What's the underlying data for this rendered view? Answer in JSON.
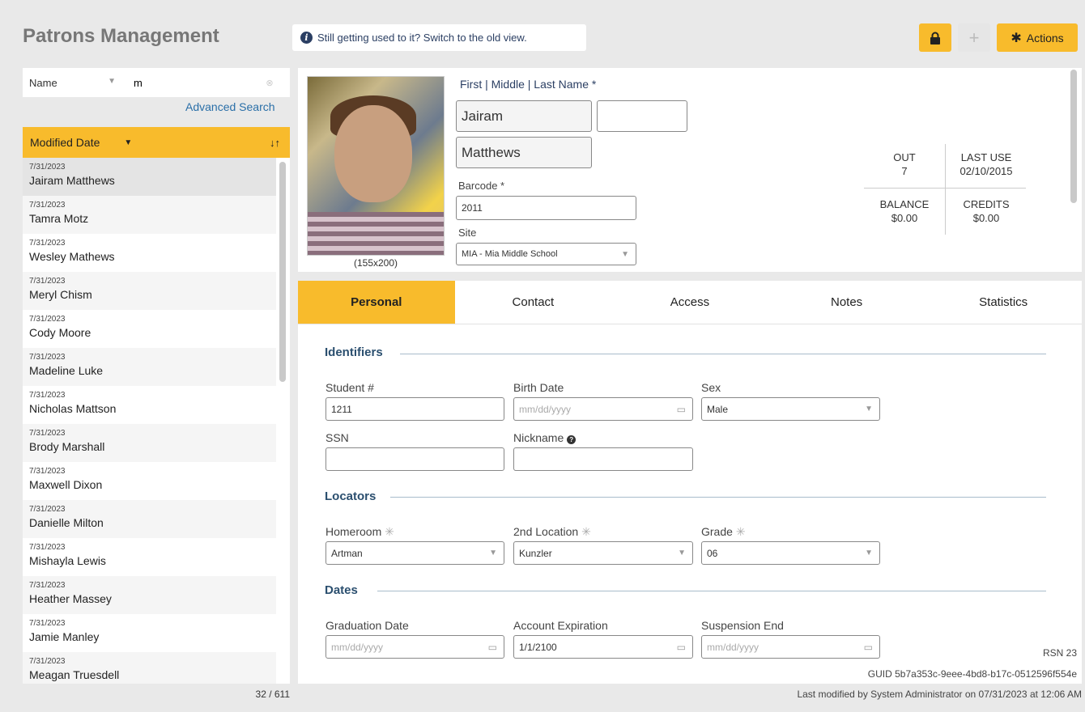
{
  "app": {
    "title": "Patrons Management"
  },
  "banner": {
    "text": "Still getting used to it? Switch to the old view."
  },
  "toolbar": {
    "plus_label": "+",
    "actions_label": "Actions"
  },
  "search": {
    "type": "Name",
    "value": "m",
    "advanced_label": "Advanced Search"
  },
  "sort": {
    "label": "Modified Date"
  },
  "patrons": [
    {
      "date": "7/31/2023",
      "name": "Jairam Matthews"
    },
    {
      "date": "7/31/2023",
      "name": "Tamra Motz"
    },
    {
      "date": "7/31/2023",
      "name": "Wesley Mathews"
    },
    {
      "date": "7/31/2023",
      "name": "Meryl Chism"
    },
    {
      "date": "7/31/2023",
      "name": "Cody Moore"
    },
    {
      "date": "7/31/2023",
      "name": "Madeline Luke"
    },
    {
      "date": "7/31/2023",
      "name": "Nicholas Mattson"
    },
    {
      "date": "7/31/2023",
      "name": "Brody Marshall"
    },
    {
      "date": "7/31/2023",
      "name": "Maxwell Dixon"
    },
    {
      "date": "7/31/2023",
      "name": "Danielle Milton"
    },
    {
      "date": "7/31/2023",
      "name": "Mishayla Lewis"
    },
    {
      "date": "7/31/2023",
      "name": "Heather Massey"
    },
    {
      "date": "7/31/2023",
      "name": "Jamie Manley"
    },
    {
      "date": "7/31/2023",
      "name": "Meagan Truesdell"
    }
  ],
  "list_count": "32 / 611",
  "patron": {
    "photo_size": "(155x200)",
    "name_label": "First | Middle | Last Name  *",
    "first": "Jairam",
    "middle": "",
    "last": "Matthews",
    "barcode_label": "Barcode *",
    "barcode": "2011",
    "site_label": "Site",
    "site": "MIA - Mia Middle School"
  },
  "stats": {
    "out_label": "OUT",
    "out": "7",
    "last_use_label": "LAST USE",
    "last_use": "02/10/2015",
    "balance_label": "BALANCE",
    "balance": "$0.00",
    "credits_label": "CREDITS",
    "credits": "$0.00"
  },
  "tabs": [
    "Personal",
    "Contact",
    "Access",
    "Notes",
    "Statistics"
  ],
  "identifiers": {
    "title": "Identifiers",
    "student_label": "Student #",
    "student": "1211",
    "birth_label": "Birth Date",
    "birth_placeholder": "mm/dd/yyyy",
    "sex_label": "Sex",
    "sex": "Male",
    "ssn_label": "SSN",
    "ssn": "",
    "nickname_label": "Nickname",
    "nickname": ""
  },
  "locators": {
    "title": "Locators",
    "homeroom_label": "Homeroom",
    "homeroom": "Artman",
    "location2_label": "2nd Location",
    "location2": "Kunzler",
    "grade_label": "Grade",
    "grade": "06"
  },
  "dates": {
    "title": "Dates",
    "graduation_label": "Graduation Date",
    "graduation_placeholder": "mm/dd/yyyy",
    "expiration_label": "Account Expiration",
    "expiration": "1/1/2100",
    "suspension_label": "Suspension End",
    "suspension_placeholder": "mm/dd/yyyy"
  },
  "footer": {
    "rsn": "RSN 23",
    "guid": "GUID 5b7a353c-9eee-4bd8-b17c-0512596f554e",
    "modified": "Last modified by System Administrator on 07/31/2023 at 12:06 AM"
  },
  "colors": {
    "accent": "#f8bb2c",
    "heading": "#2b4f6f",
    "link": "#2a6fa8"
  }
}
